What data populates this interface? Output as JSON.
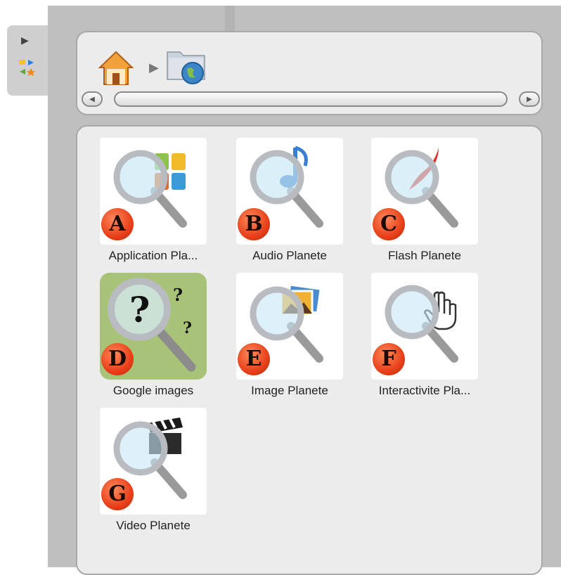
{
  "side_tab": {
    "icons": [
      "play-icon",
      "mini-apps-icon"
    ]
  },
  "nav": {
    "icons": [
      "home-icon",
      "chevron-right-icon",
      "folder-globe-icon"
    ],
    "scroll_left": "◀",
    "scroll_right": "▶"
  },
  "items": [
    {
      "label": "Application Pla...",
      "badge": "A",
      "icon": "search-apps-icon"
    },
    {
      "label": "Audio Planete",
      "badge": "B",
      "icon": "search-audio-icon"
    },
    {
      "label": "Flash Planete",
      "badge": "C",
      "icon": "search-flash-icon"
    },
    {
      "label": "Google images",
      "badge": "D",
      "icon": "search-question-icon",
      "selected": true
    },
    {
      "label": "Image Planete",
      "badge": "E",
      "icon": "search-image-icon"
    },
    {
      "label": "Interactivite Pla...",
      "badge": "F",
      "icon": "search-hand-icon"
    },
    {
      "label": "Video Planete",
      "badge": "G",
      "icon": "search-video-icon"
    }
  ],
  "colors": {
    "selected_tile": "#a8c277",
    "badge": "#e8401a",
    "panel": "#bfbfbf",
    "card": "#ececec"
  }
}
